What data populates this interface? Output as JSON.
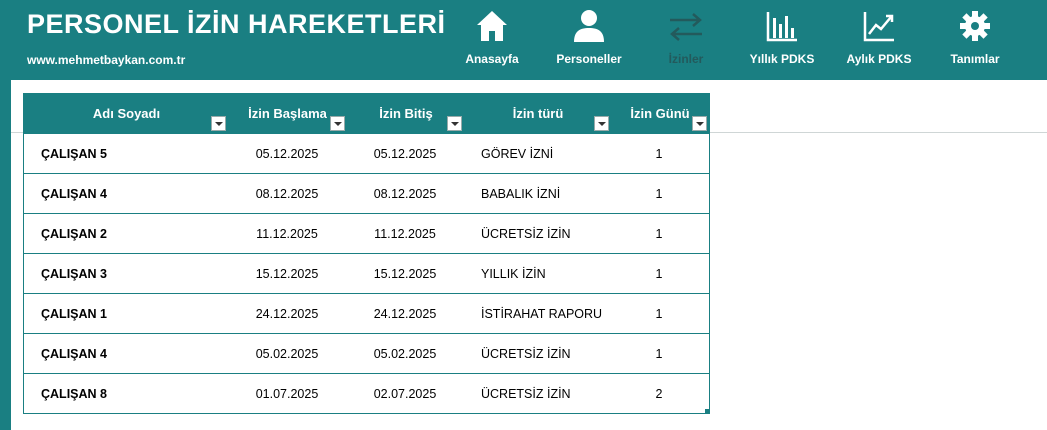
{
  "header": {
    "title": "PERSONEL İZİN HAREKETLERİ",
    "site": "www.mehmetbaykan.com.tr",
    "colors": {
      "accent": "#1a7f82",
      "inactive_label": "#235a5c"
    }
  },
  "nav": [
    {
      "label": "Anasayfa",
      "icon": "home-icon"
    },
    {
      "label": "Personeller",
      "icon": "user-icon"
    },
    {
      "label": "İzinler",
      "icon": "swap-arrows-icon",
      "active": true
    },
    {
      "label": "Yıllık PDKS",
      "icon": "bar-chart-icon"
    },
    {
      "label": "Aylık PDKS",
      "icon": "line-chart-icon"
    },
    {
      "label": "Tanımlar",
      "icon": "gear-icon"
    }
  ],
  "table": {
    "columns": [
      "Adı Soyadı",
      "İzin Başlama",
      "İzin Bitiş",
      "İzin türü",
      "İzin Günü"
    ],
    "rows": [
      [
        "ÇALIŞAN 5",
        "05.12.2025",
        "05.12.2025",
        "GÖREV İZNİ",
        "1"
      ],
      [
        "ÇALIŞAN 4",
        "08.12.2025",
        "08.12.2025",
        "BABALIK İZNİ",
        "1"
      ],
      [
        "ÇALIŞAN 2",
        "11.12.2025",
        "11.12.2025",
        "ÜCRETSİZ İZİN",
        "1"
      ],
      [
        "ÇALIŞAN 3",
        "15.12.2025",
        "15.12.2025",
        "YILLIK İZİN",
        "1"
      ],
      [
        "ÇALIŞAN 1",
        "24.12.2025",
        "24.12.2025",
        "İSTİRAHAT RAPORU",
        "1"
      ],
      [
        "ÇALIŞAN 4",
        "05.02.2025",
        "05.02.2025",
        "ÜCRETSİZ İZİN",
        "1"
      ],
      [
        "ÇALIŞAN 8",
        "01.07.2025",
        "02.07.2025",
        "ÜCRETSİZ İZİN",
        "2"
      ]
    ]
  }
}
